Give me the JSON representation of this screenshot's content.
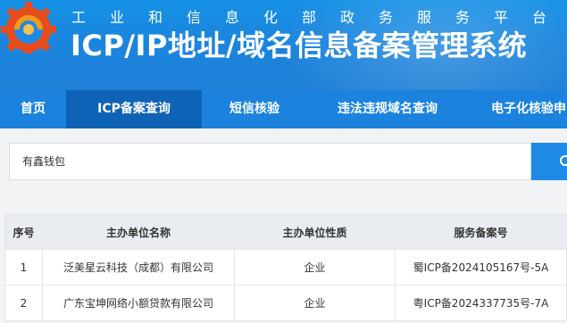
{
  "header": {
    "subtitle": "工业和信息化部政务服务平台",
    "title": "ICP/IP地址/域名信息备案管理系统",
    "colors": {
      "banner": "#1b82de",
      "logo_red": "#e84c1a",
      "logo_orange": "#f29a1d"
    }
  },
  "nav": {
    "items": [
      {
        "label": "首页"
      },
      {
        "label": "ICP备案查询",
        "active": true
      },
      {
        "label": "短信核验"
      },
      {
        "label": "违法违规域名查询"
      },
      {
        "label": "电子化核验申"
      }
    ]
  },
  "search": {
    "value": "有鑫钱包",
    "button_icon": "search-icon"
  },
  "table": {
    "columns": [
      "序号",
      "主办单位名称",
      "主办单位性质",
      "服务备案号"
    ],
    "rows": [
      [
        "1",
        "泛美星云科技（成都）有限公司",
        "企业",
        "蜀ICP备2024105167号-5A"
      ],
      [
        "2",
        "广东宝坤网络小额贷款有限公司",
        "企业",
        "粤ICP备2024337735号-7A"
      ]
    ]
  }
}
